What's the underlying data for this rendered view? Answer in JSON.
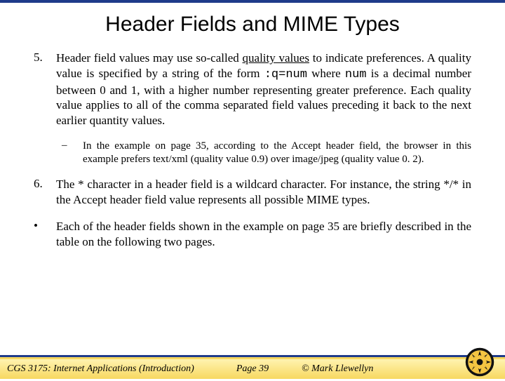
{
  "title": "Header Fields and MIME Types",
  "items": {
    "5": {
      "num": "5.",
      "pre": "Header field values may use so-called ",
      "quality": "quality values",
      "mid1": " to indicate preferences.  A quality value is specified by a string of the form ",
      "code1": ":q=num",
      "mid2": " where ",
      "code2": "num",
      "post": " is a decimal number between 0 and 1, with a higher number representing greater preference.  Each quality value applies to all of the comma separated field values preceding it back to the next earlier quantity values."
    },
    "5sub": {
      "dash": "–",
      "text": "In the example on page 35, according to the Accept header field, the browser in this example prefers text/xml (quality value 0.9) over image/jpeg (quality value 0. 2)."
    },
    "6": {
      "num": "6.",
      "text": "The * character in a header field is a wildcard character.  For instance, the string */* in the Accept header field value represents all possible MIME types."
    },
    "bullet": {
      "num": "•",
      "text": "Each of the header fields shown in the example on page 35 are briefly described in the table on the following two pages."
    }
  },
  "footer": {
    "course": "CGS 3175: Internet Applications (Introduction)",
    "page": "Page 39",
    "copyright": "© Mark Llewellyn"
  }
}
